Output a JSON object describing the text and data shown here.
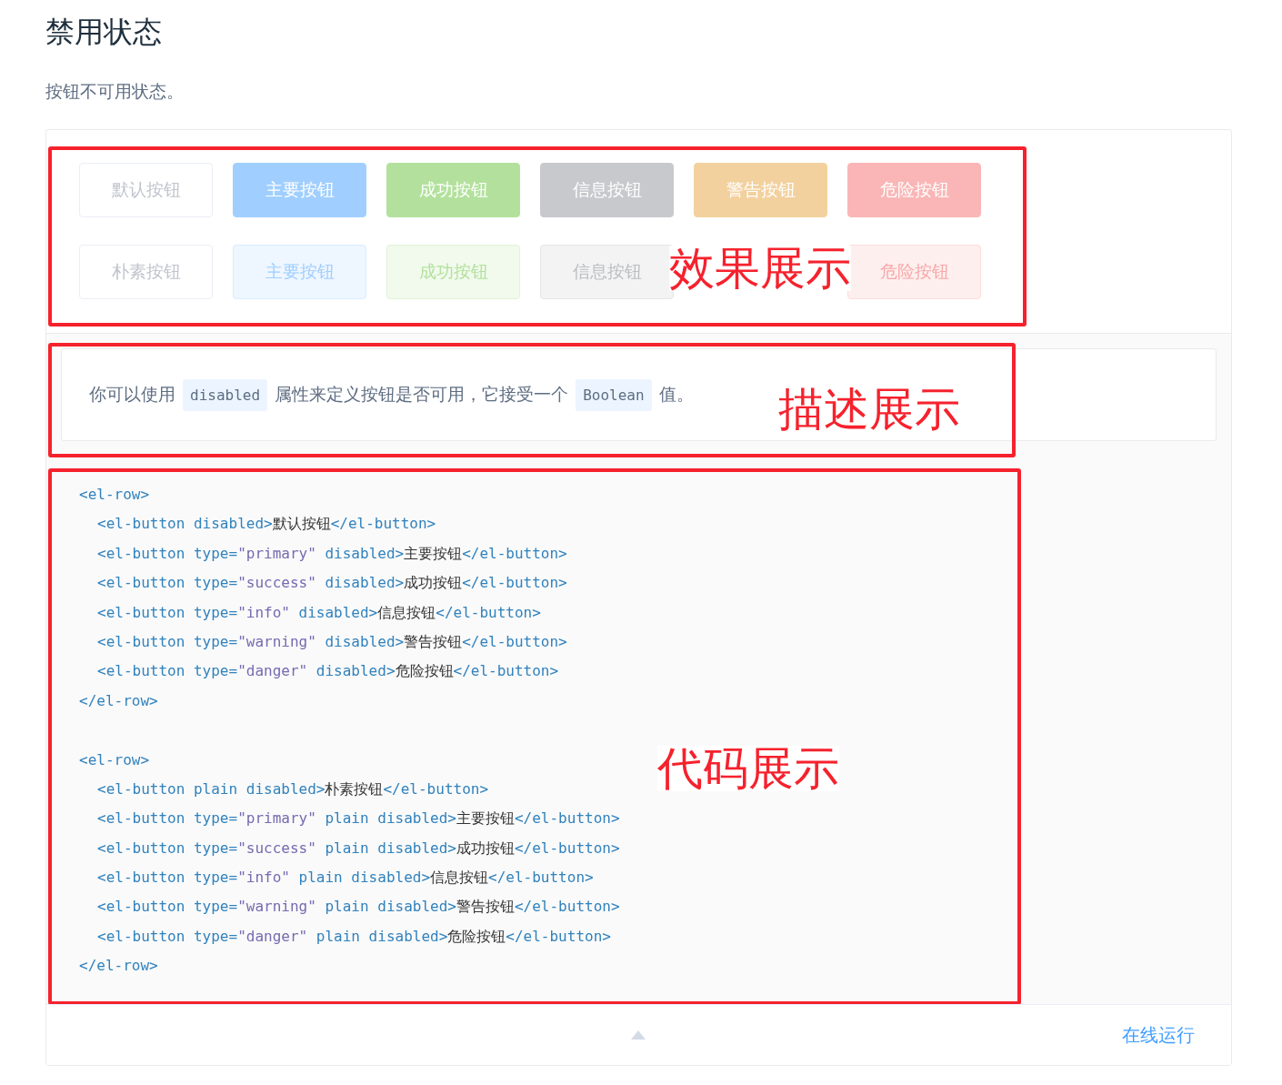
{
  "title": "禁用状态",
  "subtitle": "按钮不可用状态。",
  "demo": {
    "button_rows": [
      [
        {
          "label": "默认按钮",
          "kind": "outline",
          "color": "#c0c4cc"
        },
        {
          "label": "主要按钮",
          "kind": "solid",
          "color": "#a0cfff"
        },
        {
          "label": "成功按钮",
          "kind": "solid",
          "color": "#b3e19d"
        },
        {
          "label": "信息按钮",
          "kind": "solid",
          "color": "#c8c9cc"
        },
        {
          "label": "警告按钮",
          "kind": "solid",
          "color": "#f3d19e"
        },
        {
          "label": "危险按钮",
          "kind": "solid",
          "color": "#fab6b6"
        }
      ],
      [
        {
          "label": "朴素按钮",
          "kind": "outline",
          "color": "#c0c4cc"
        },
        {
          "label": "主要按钮",
          "kind": "plain",
          "color": "#a0cfff"
        },
        {
          "label": "成功按钮",
          "kind": "plain",
          "color": "#b3e19d"
        },
        {
          "label": "信息按钮",
          "kind": "plain",
          "color": "#bcbec2"
        },
        {
          "kind": "covered"
        },
        {
          "label": "危险按钮",
          "kind": "plain",
          "color": "#f9a7a7"
        }
      ]
    ],
    "description": [
      {
        "kind": "text",
        "text": "你可以使用 "
      },
      {
        "kind": "code",
        "text": "disabled"
      },
      {
        "kind": "text",
        "text": " 属性来定义按钮是否可用，它接受一个 "
      },
      {
        "kind": "code",
        "text": "Boolean"
      },
      {
        "kind": "text",
        "text": " 值。"
      }
    ],
    "code_blocks": [
      {
        "open": [
          {
            "kind": "tag",
            "text": "<el-row>"
          }
        ],
        "children": [
          [
            {
              "kind": "tag",
              "text": "<el-button disabled>"
            },
            {
              "kind": "text",
              "text": "默认按钮"
            },
            {
              "kind": "tag",
              "text": "</el-button>"
            }
          ],
          [
            {
              "kind": "tag",
              "text": "<el-button type="
            },
            {
              "kind": "string",
              "text": "\"primary\""
            },
            {
              "kind": "tag",
              "text": " disabled>"
            },
            {
              "kind": "text",
              "text": "主要按钮"
            },
            {
              "kind": "tag",
              "text": "</el-button>"
            }
          ],
          [
            {
              "kind": "tag",
              "text": "<el-button type="
            },
            {
              "kind": "string",
              "text": "\"success\""
            },
            {
              "kind": "tag",
              "text": " disabled>"
            },
            {
              "kind": "text",
              "text": "成功按钮"
            },
            {
              "kind": "tag",
              "text": "</el-button>"
            }
          ],
          [
            {
              "kind": "tag",
              "text": "<el-button type="
            },
            {
              "kind": "string",
              "text": "\"info\""
            },
            {
              "kind": "tag",
              "text": " disabled>"
            },
            {
              "kind": "text",
              "text": "信息按钮"
            },
            {
              "kind": "tag",
              "text": "</el-button>"
            }
          ],
          [
            {
              "kind": "tag",
              "text": "<el-button type="
            },
            {
              "kind": "string",
              "text": "\"warning\""
            },
            {
              "kind": "tag",
              "text": " disabled>"
            },
            {
              "kind": "text",
              "text": "警告按钮"
            },
            {
              "kind": "tag",
              "text": "</el-button>"
            }
          ],
          [
            {
              "kind": "tag",
              "text": "<el-button type="
            },
            {
              "kind": "string",
              "text": "\"danger\""
            },
            {
              "kind": "tag",
              "text": " disabled>"
            },
            {
              "kind": "text",
              "text": "危险按钮"
            },
            {
              "kind": "tag",
              "text": "</el-button>"
            }
          ]
        ],
        "close": [
          {
            "kind": "tag",
            "text": "</el-row>"
          }
        ]
      },
      {
        "open": [
          {
            "kind": "tag",
            "text": "<el-row>"
          }
        ],
        "children": [
          [
            {
              "kind": "tag",
              "text": "<el-button plain disabled>"
            },
            {
              "kind": "text",
              "text": "朴素按钮"
            },
            {
              "kind": "tag",
              "text": "</el-button>"
            }
          ],
          [
            {
              "kind": "tag",
              "text": "<el-button type="
            },
            {
              "kind": "string",
              "text": "\"primary\""
            },
            {
              "kind": "tag",
              "text": " plain disabled>"
            },
            {
              "kind": "text",
              "text": "主要按钮"
            },
            {
              "kind": "tag",
              "text": "</el-button>"
            }
          ],
          [
            {
              "kind": "tag",
              "text": "<el-button type="
            },
            {
              "kind": "string",
              "text": "\"success\""
            },
            {
              "kind": "tag",
              "text": " plain disabled>"
            },
            {
              "kind": "text",
              "text": "成功按钮"
            },
            {
              "kind": "tag",
              "text": "</el-button>"
            }
          ],
          [
            {
              "kind": "tag",
              "text": "<el-button type="
            },
            {
              "kind": "string",
              "text": "\"info\""
            },
            {
              "kind": "tag",
              "text": " plain disabled>"
            },
            {
              "kind": "text",
              "text": "信息按钮"
            },
            {
              "kind": "tag",
              "text": "</el-button>"
            }
          ],
          [
            {
              "kind": "tag",
              "text": "<el-button type="
            },
            {
              "kind": "string",
              "text": "\"warning\""
            },
            {
              "kind": "tag",
              "text": " plain disabled>"
            },
            {
              "kind": "text",
              "text": "警告按钮"
            },
            {
              "kind": "tag",
              "text": "</el-button>"
            }
          ],
          [
            {
              "kind": "tag",
              "text": "<el-button type="
            },
            {
              "kind": "string",
              "text": "\"danger\""
            },
            {
              "kind": "tag",
              "text": " plain disabled>"
            },
            {
              "kind": "text",
              "text": "危险按钮"
            },
            {
              "kind": "tag",
              "text": "</el-button>"
            }
          ]
        ],
        "close": [
          {
            "kind": "tag",
            "text": "</el-row>"
          }
        ]
      }
    ],
    "run_link": "在线运行"
  },
  "annotations": [
    {
      "label": "效果展示"
    },
    {
      "label": "描述展示"
    },
    {
      "label": "代码展示"
    }
  ]
}
